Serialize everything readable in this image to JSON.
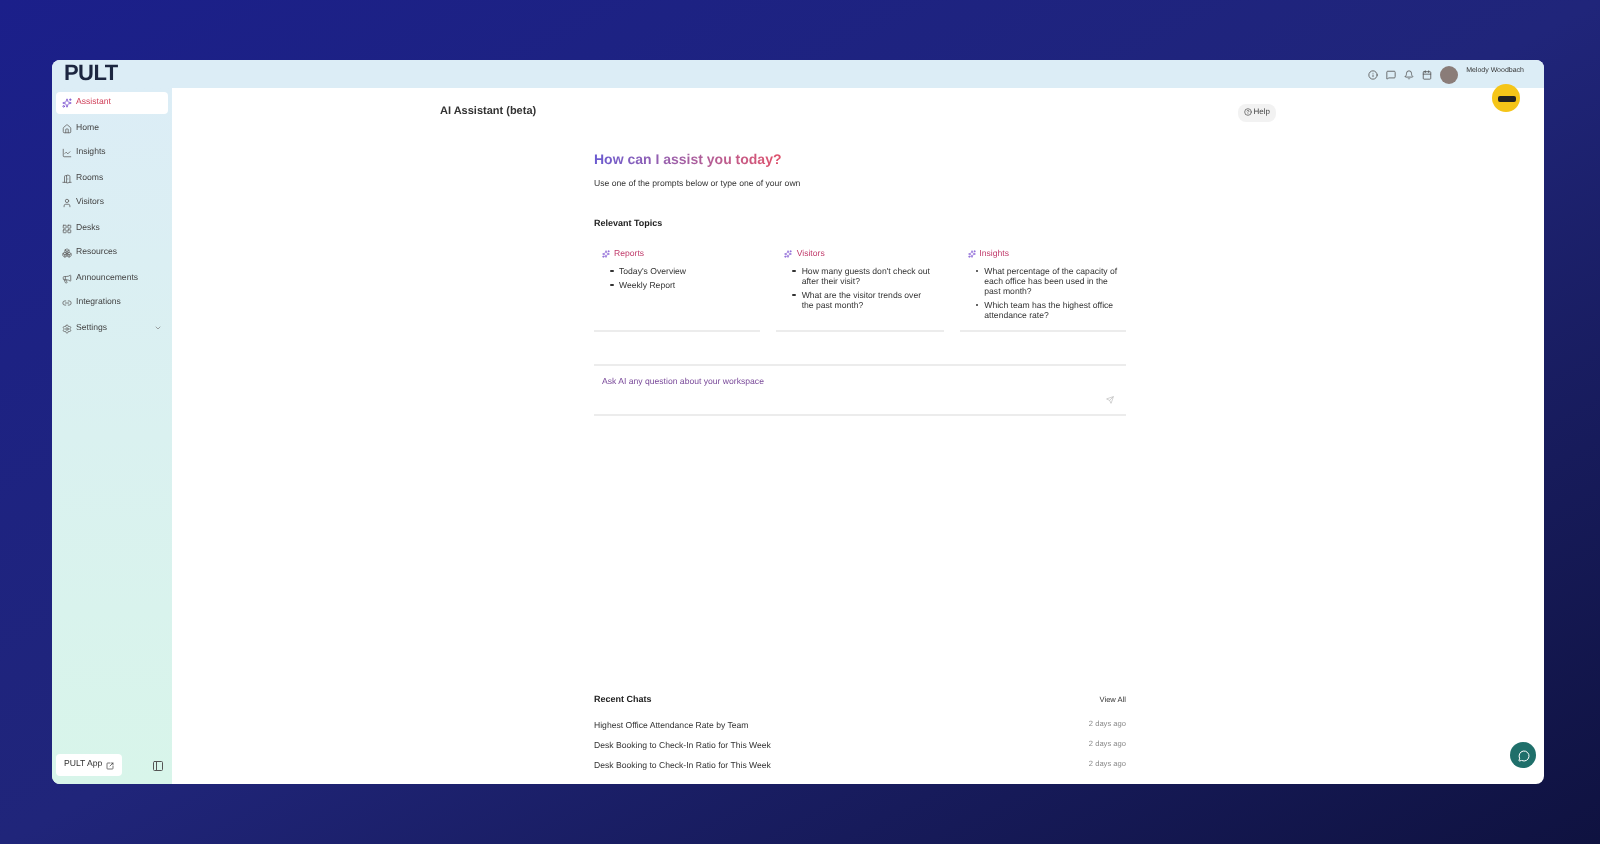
{
  "logo": "PULT",
  "sidebar": {
    "items": [
      {
        "label": "Assistant",
        "selected": true,
        "kind": "link"
      },
      {
        "label": "Home",
        "selected": false,
        "kind": "link"
      },
      {
        "label": "Insights",
        "selected": false,
        "kind": "link"
      },
      {
        "label": "Rooms",
        "selected": false,
        "kind": "link"
      },
      {
        "label": "Visitors",
        "selected": false,
        "kind": "link"
      },
      {
        "label": "Desks",
        "selected": false,
        "kind": "link"
      },
      {
        "label": "Resources",
        "selected": false,
        "kind": "link"
      },
      {
        "label": "Announcements",
        "selected": false,
        "kind": "link"
      },
      {
        "label": "Integrations",
        "selected": false,
        "kind": "link"
      },
      {
        "label": "Settings",
        "selected": false,
        "kind": "group"
      }
    ],
    "app_button": "PULT App"
  },
  "header": {
    "user_name": "Melody Woodbach"
  },
  "page": {
    "title": "AI Assistant (beta)",
    "help": "Help"
  },
  "assistant": {
    "heading": "How can I assist you today?",
    "subtitle": "Use one of the prompts below or type one of your own",
    "topics_title": "Relevant Topics",
    "topics": [
      {
        "title": "Reports",
        "prompts": [
          "Today's Overview",
          "Weekly Report"
        ]
      },
      {
        "title": "Visitors",
        "prompts": [
          "How many guests don't check out after their visit?",
          "What are the visitor trends over the past month?"
        ]
      },
      {
        "title": "Insights",
        "prompts": [
          "What percentage of the capacity of each office has been used in the past month?",
          "Which team has the highest office attendance rate?"
        ]
      }
    ],
    "input": {
      "placeholder": "Ask AI any question about your workspace"
    }
  },
  "recent_chats": {
    "title": "Recent Chats",
    "view_all": "View All",
    "items": [
      {
        "title": "Highest Office Attendance Rate by Team",
        "time": "2 days ago"
      },
      {
        "title": "Desk Booking to Check-In Ratio for This Week",
        "time": "2 days ago"
      },
      {
        "title": "Desk Booking to Check-In Ratio for This Week",
        "time": "2 days ago"
      }
    ]
  }
}
